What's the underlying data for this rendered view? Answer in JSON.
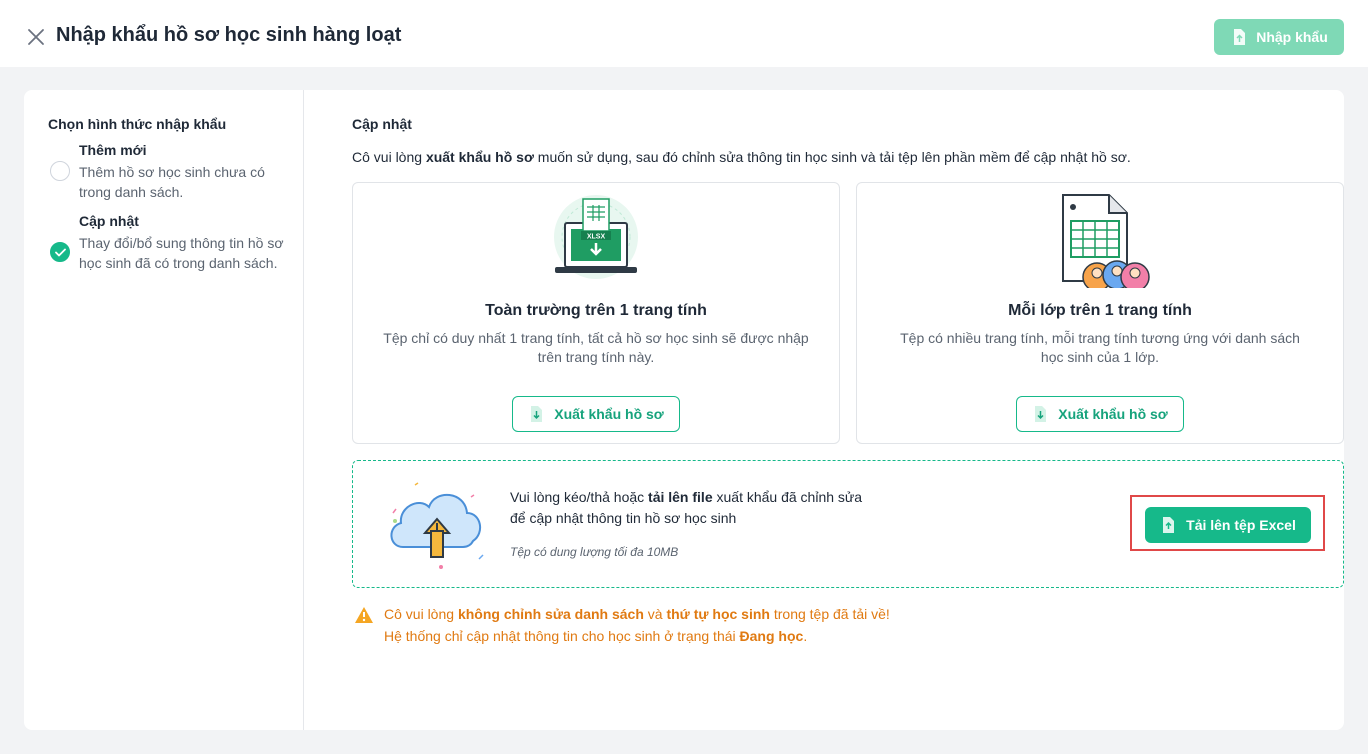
{
  "header": {
    "title": "Nhập khẩu hồ sơ học sinh hàng loạt",
    "import_label": "Nhập khẩu",
    "close_icon": "close-icon",
    "import_icon": "file-upload-icon"
  },
  "sidebar": {
    "title": "Chọn hình thức nhập khẩu",
    "options": [
      {
        "title": "Thêm mới",
        "desc": "Thêm hồ sơ học sinh chưa có trong danh sách.",
        "checked": false
      },
      {
        "title": "Cập nhật",
        "desc": "Thay đổi/bổ sung thông tin hồ sơ học sinh đã có trong danh sách.",
        "checked": true
      }
    ]
  },
  "main": {
    "section_title": "Cập nhật",
    "instruction": {
      "prefix": "Cô vui lòng ",
      "bold": "xuất khẩu hồ sơ",
      "suffix": " muốn sử dụng, sau đó chỉnh sửa thông tin học sinh và tải tệp lên phần mềm để cập nhật hồ sơ."
    },
    "cards": [
      {
        "title": "Toàn trường trên 1 trang tính",
        "desc": "Tệp chỉ có duy nhất 1 trang tính, tất cả hồ sơ học sinh sẽ được nhập trên trang tính này.",
        "button": "Xuất khẩu hồ sơ",
        "illus_label": "XLSX",
        "illus_icon": "laptop-xlsx-icon"
      },
      {
        "title": "Mỗi lớp trên 1 trang tính",
        "desc": "Tệp có nhiều trang tính, mỗi trang tính tương ứng với danh sách học sinh của 1 lớp.",
        "button": "Xuất khẩu hồ sơ",
        "illus_icon": "spreadsheet-people-icon"
      }
    ],
    "upload": {
      "text_prefix": "Vui lòng kéo/thả hoặc ",
      "text_bold": "tải lên file",
      "text_suffix": " xuất khẩu đã chỉnh sửa",
      "text_line2": "để cập nhật thông tin hồ sơ học sinh",
      "note": "Tệp có dung lượng tối đa 10MB",
      "button": "Tải lên tệp Excel",
      "illus_icon": "cloud-upload-icon"
    },
    "warning": {
      "l1_a": "Cô vui lòng ",
      "l1_b": "không chỉnh sửa danh sách",
      "l1_c": " và ",
      "l1_d": "thứ tự học sinh",
      "l1_e": " trong tệp đã tải về!",
      "l2_a": "Hệ thống chỉ cập nhật thông tin cho học sinh ở trạng thái ",
      "l2_b": "Đang học",
      "l2_c": ".",
      "icon": "warning-icon"
    }
  },
  "colors": {
    "accent": "#16b98a",
    "accent_light": "#7fd9b6",
    "warning": "#e07a12",
    "highlight_border": "#e04848"
  }
}
